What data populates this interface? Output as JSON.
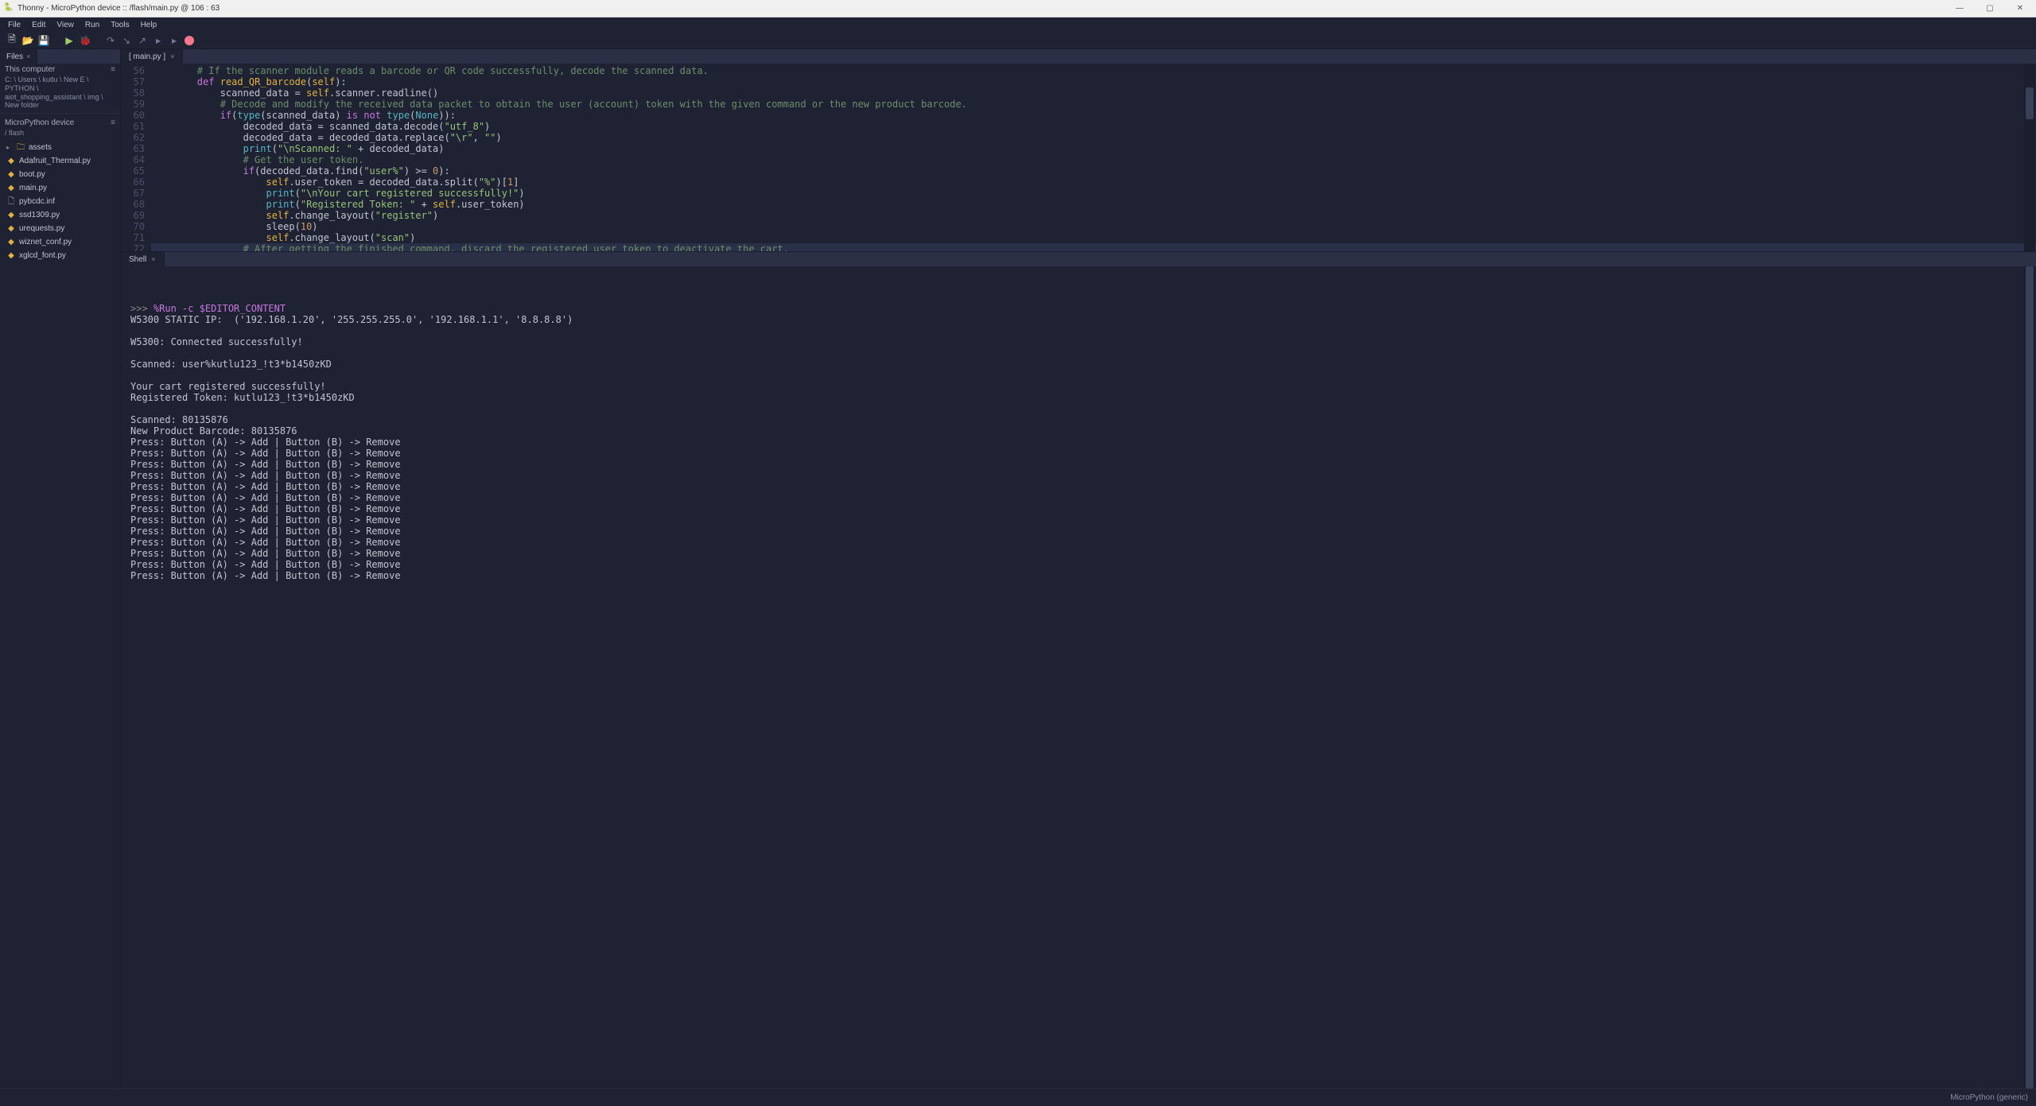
{
  "titlebar": {
    "text": "Thonny  -  MicroPython device :: /flash/main.py  @  106 : 63"
  },
  "menus": [
    "File",
    "Edit",
    "View",
    "Run",
    "Tools",
    "Help"
  ],
  "sidebar": {
    "tab": "Files",
    "this_computer": {
      "label": "This computer",
      "path": "C: \\ Users \\ kutlu \\ New E \\ PYTHON \\ aiot_shopping_assistant \\ img \\ New folder"
    },
    "device": {
      "label": "MicroPython device",
      "path": "/ flash",
      "items": [
        {
          "icon": "fold",
          "name": "assets",
          "type": "folder"
        },
        {
          "icon": "py",
          "name": "Adafruit_Thermal.py",
          "type": "py"
        },
        {
          "icon": "py",
          "name": "boot.py",
          "type": "py"
        },
        {
          "icon": "py",
          "name": "main.py",
          "type": "py"
        },
        {
          "icon": "generic",
          "name": "pybcdc.inf",
          "type": "inf"
        },
        {
          "icon": "py",
          "name": "ssd1309.py",
          "type": "py"
        },
        {
          "icon": "py",
          "name": "urequests.py",
          "type": "py"
        },
        {
          "icon": "py",
          "name": "wiznet_conf.py",
          "type": "py"
        },
        {
          "icon": "py",
          "name": "xglcd_font.py",
          "type": "py"
        }
      ]
    }
  },
  "editor": {
    "tab": "[ main.py ]",
    "first_line": 56,
    "last_line": 72,
    "code_html": [
      "        <span class='comment'># If the scanner module reads a barcode or QR code successfully, decode the scanned data.</span>",
      "        <span class='kw'>def</span> <span class='fn'>read_QR_barcode</span>(<span class='self'>self</span>):",
      "            scanned_data = <span class='self'>self</span>.scanner.readline()",
      "            <span class='comment'># Decode and modify the received data packet to obtain the user (account) token with the given command or the new product barcode.</span>",
      "            <span class='kw'>if</span>(<span class='builtin'>type</span>(scanned_data) <span class='kw'>is not</span> <span class='builtin'>type</span>(<span class='const'>None</span>)):",
      "                decoded_data = scanned_data.decode(<span class='str'>\"utf_8\"</span>)",
      "                decoded_data = decoded_data.replace(<span class='str'>\"\\r\"</span>, <span class='str'>\"\"</span>)",
      "                <span class='builtin'>print</span>(<span class='str'>\"\\nScanned: \"</span> + decoded_data)",
      "                <span class='comment'># Get the user token.</span>",
      "                <span class='kw'>if</span>(decoded_data.find(<span class='str'>\"user%\"</span>) >= <span class='num'>0</span>):",
      "                    <span class='self'>self</span>.user_token = decoded_data.split(<span class='str'>\"%\"</span>)[<span class='num'>1</span>]",
      "                    <span class='builtin'>print</span>(<span class='str'>\"\\nYour cart registered successfully!\"</span>)",
      "                    <span class='builtin'>print</span>(<span class='str'>\"Registered Token: \"</span> + <span class='self'>self</span>.user_token)",
      "                    <span class='self'>self</span>.change_layout(<span class='str'>\"register\"</span>)",
      "                    sleep(<span class='num'>10</span>)",
      "                    <span class='self'>self</span>.change_layout(<span class='str'>\"scan\"</span>)",
      "                <span class='comment'># After getting the finished command, discard the registered user token to deactivate the cart.</span>"
    ]
  },
  "shell": {
    "tab": "Shell",
    "prompt": ">>> ",
    "magic": "%Run -c $EDITOR_CONTENT",
    "lines": [
      "W5300 STATIC IP:  ('192.168.1.20', '255.255.255.0', '192.168.1.1', '8.8.8.8')",
      "",
      "W5300: Connected successfully!",
      "",
      "Scanned: user%kutlu123_!t3*b1450zKD",
      "",
      "Your cart registered successfully!",
      "Registered Token: kutlu123_!t3*b1450zKD",
      "",
      "Scanned: 80135876",
      "New Product Barcode: 80135876",
      "Press: Button (A) -> Add | Button (B) -> Remove",
      "Press: Button (A) -> Add | Button (B) -> Remove",
      "Press: Button (A) -> Add | Button (B) -> Remove",
      "Press: Button (A) -> Add | Button (B) -> Remove",
      "Press: Button (A) -> Add | Button (B) -> Remove",
      "Press: Button (A) -> Add | Button (B) -> Remove",
      "Press: Button (A) -> Add | Button (B) -> Remove",
      "Press: Button (A) -> Add | Button (B) -> Remove",
      "Press: Button (A) -> Add | Button (B) -> Remove",
      "Press: Button (A) -> Add | Button (B) -> Remove",
      "Press: Button (A) -> Add | Button (B) -> Remove",
      "Press: Button (A) -> Add | Button (B) -> Remove",
      "Press: Button (A) -> Add | Button (B) -> Remove"
    ]
  },
  "status": {
    "interpreter": "MicroPython (generic)"
  },
  "win_buttons": {
    "min": "—",
    "max": "▢",
    "close": "✕"
  }
}
